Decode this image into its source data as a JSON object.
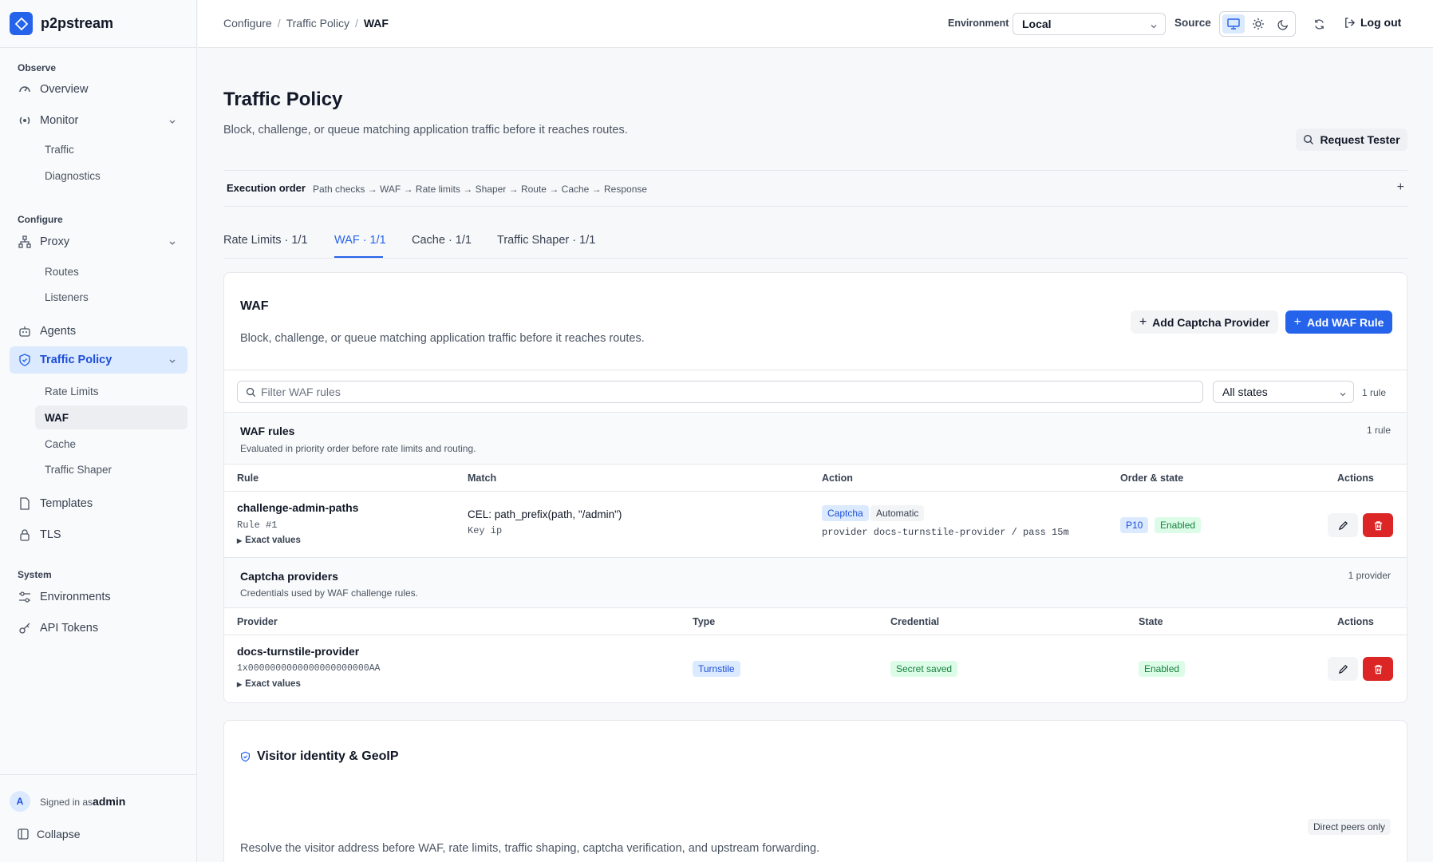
{
  "app": {
    "name": "p2pstream"
  },
  "sidebar": {
    "sections": {
      "observe": "Observe",
      "configure": "Configure",
      "system": "System"
    },
    "overview": "Overview",
    "monitor": "Monitor",
    "monitor_items": [
      "Traffic",
      "Diagnostics"
    ],
    "proxy": "Proxy",
    "proxy_items": [
      "Routes",
      "Listeners"
    ],
    "agents": "Agents",
    "traffic_policy": "Traffic Policy",
    "traffic_policy_items": [
      "Rate Limits",
      "WAF",
      "Cache",
      "Traffic Shaper"
    ],
    "templates": "Templates",
    "tls": "TLS",
    "environments": "Environments",
    "api_tokens": "API Tokens",
    "footer": {
      "avatar": "A",
      "signed_in": "Signed in as",
      "user": "admin",
      "collapse": "Collapse"
    }
  },
  "topbar": {
    "breadcrumb": [
      "Configure",
      "Traffic Policy",
      "WAF"
    ],
    "environment_label": "Environment",
    "environment_value": "Local",
    "source_label": "Source",
    "logout": "Log out"
  },
  "page": {
    "title": "Traffic Policy",
    "description": "Block, challenge, or queue matching application traffic before it reaches routes.",
    "request_tester": "Request Tester",
    "execution_order_label": "Execution order",
    "execution_order": "Path checks → WAF → Rate limits → Shaper → Route → Cache → Response",
    "expand": "+",
    "tabs": [
      "Rate Limits · 1/1",
      "WAF · 1/1",
      "Cache · 1/1",
      "Traffic Shaper · 1/1"
    ]
  },
  "waf": {
    "title": "WAF",
    "description": "Block, challenge, or queue matching application traffic before it reaches routes.",
    "add_captcha": "Add Captcha Provider",
    "add_rule": "Add WAF Rule",
    "filter_placeholder": "Filter WAF rules",
    "state_filter": "All states",
    "rule_count": "1 rule",
    "rules_section": {
      "title": "WAF rules",
      "subtitle": "Evaluated in priority order before rate limits and routing.",
      "count": "1 rule"
    },
    "rule_columns": [
      "Rule",
      "Match",
      "Action",
      "Order & state",
      "Actions"
    ],
    "rules": [
      {
        "name": "challenge-admin-paths",
        "index": "Rule #1",
        "exact": "Exact values",
        "match": "CEL: path_prefix(path, \"/admin\")",
        "key": "Key ip",
        "action_badges": [
          "Captcha",
          "Automatic"
        ],
        "action_detail": "provider docs-turnstile-provider / pass 15m",
        "priority": "P10",
        "state": "Enabled"
      }
    ],
    "providers_section": {
      "title": "Captcha providers",
      "subtitle": "Credentials used by WAF challenge rules.",
      "count": "1 provider"
    },
    "provider_columns": [
      "Provider",
      "Type",
      "Credential",
      "State",
      "Actions"
    ],
    "providers": [
      {
        "name": "docs-turnstile-provider",
        "key": "1x0000000000000000000000AA",
        "exact": "Exact values",
        "type": "Turnstile",
        "credential": "Secret saved",
        "state": "Enabled"
      }
    ]
  },
  "visitor": {
    "title": "Visitor identity & GeoIP",
    "badge": "Direct peers only",
    "description": "Resolve the visitor address before WAF, rate limits, traffic shaping, captcha verification, and upstream forwarding."
  },
  "colors": {
    "accent": "#2563eb",
    "danger": "#dc2626",
    "success_bg": "#dcfce7",
    "success_fg": "#15803d"
  }
}
